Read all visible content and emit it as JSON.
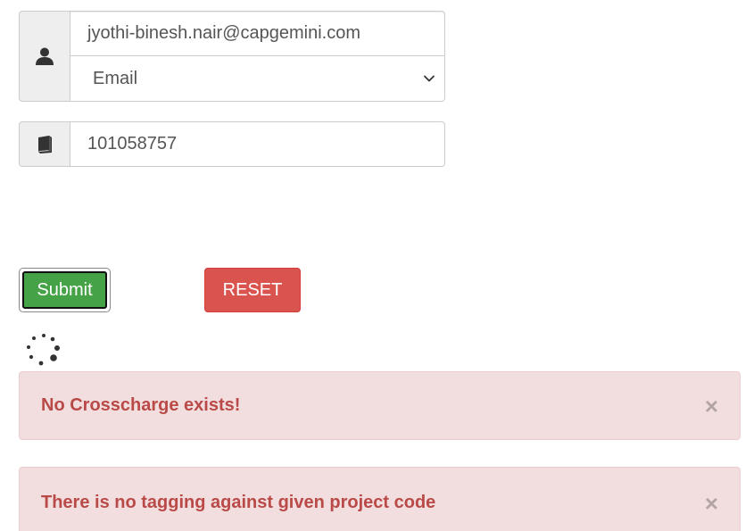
{
  "form": {
    "user_icon": "user-icon",
    "email_value": "jyothi-binesh.nair@capgemini.com",
    "type_select": {
      "selected": "Email",
      "icon": "chevron-down-icon"
    },
    "code_icon": "book-icon",
    "project_code_value": "101058757"
  },
  "buttons": {
    "submit_label": "Submit",
    "reset_label": "RESET",
    "submit_color": "#45a247",
    "reset_color": "#d9534f"
  },
  "spinner": {
    "icon": "loading-spinner-icon"
  },
  "alerts": [
    {
      "message": "No Crosscharge exists!",
      "close_label": "×"
    },
    {
      "message": "There is no tagging against given project code",
      "close_label": "×"
    }
  ],
  "colors": {
    "alert_background": "#f2dede",
    "alert_text": "#b94a48",
    "addon_background": "#eeeeee"
  }
}
